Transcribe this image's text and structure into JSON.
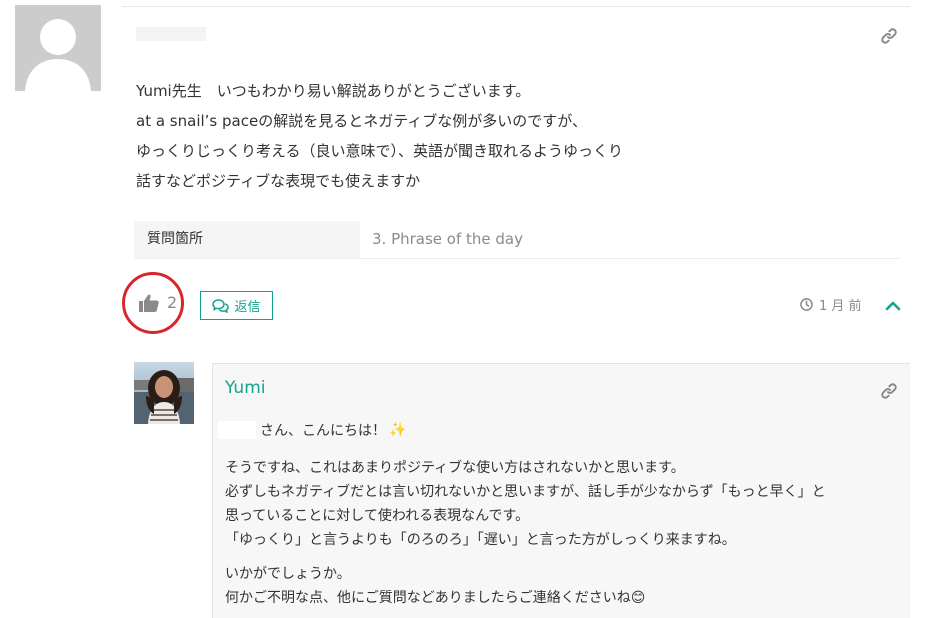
{
  "comment": {
    "author_name": "",
    "body_lines": [
      "Yumi先生　いつもわかり易い解説ありがとうございます。",
      "at a snail’s paceの解説を見るとネガティブな例が多いのですが、",
      "ゆっくりじっくり考える（良い意味で）、英語が聞き取れるようゆっくり",
      "話すなどポジティブな表現でも使えますか"
    ],
    "meta_label": "質問箇所",
    "meta_value": "3. Phrase of the day",
    "like_count": "2",
    "reply_label": "返信",
    "time_ago": "1 月 前",
    "icons": {
      "link": "link-icon",
      "like": "thumbs-up-icon",
      "reply": "comments-icon",
      "clock": "clock-icon",
      "collapse": "chevron-up-icon"
    }
  },
  "reply": {
    "author_name": "Yumi",
    "greeting": "さん、こんにちは！",
    "greeting_emoji": "✨",
    "paragraphs": [
      [
        "そうですね、これはあまりポジティブな使い方はされないかと思います。",
        "必ずしもネガティブだとは言い切れないかと思いますが、話し手が少なからず「もっと早く」と",
        "思っていることに対して使われる表現なんです。",
        "「ゆっくり」と言うよりも「のろのろ」「遅い」と言った方がしっくり来ますね。"
      ],
      [
        "いかがでしょうか。",
        "何かご不明な点、他にご質問などありましたらご連絡くださいね😊"
      ]
    ]
  },
  "colors": {
    "accent": "#12a38e",
    "highlight_circle": "#d8262d",
    "muted_text": "#8a8a8a"
  }
}
